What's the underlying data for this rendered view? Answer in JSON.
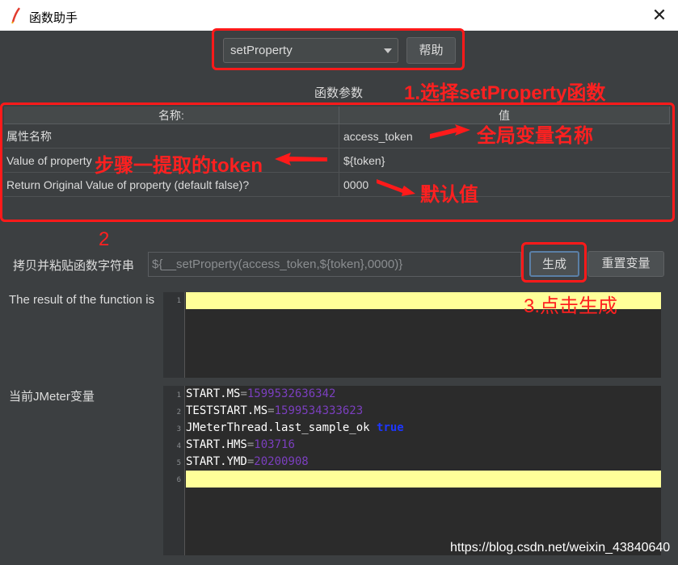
{
  "window": {
    "title": "函数助手",
    "close_glyph": "✕"
  },
  "function_select": {
    "value": "setProperty"
  },
  "help_button": "帮助",
  "params_label": "函数参数",
  "table": {
    "headers": {
      "name": "名称:",
      "value": "值"
    },
    "rows": [
      {
        "name": "属性名称",
        "value": "access_token"
      },
      {
        "name": "Value of property",
        "value": "${token}"
      },
      {
        "name": "Return Original Value of property (default false)?",
        "value": "0000"
      }
    ]
  },
  "copy_label": "拷贝并粘贴函数字符串",
  "function_string": "${__setProperty(access_token,${token},0000)}",
  "generate_button": "生成",
  "reset_button": "重置变量",
  "result_label": "The result of the function is",
  "result_editor": {
    "line_numbers": [
      "1"
    ]
  },
  "vars_label": "当前JMeter变量",
  "vars_editor": {
    "line_numbers": [
      "1",
      "2",
      "3",
      "4",
      "5",
      "6"
    ],
    "lines": [
      {
        "key": "START.MS",
        "sep": "=",
        "value": "1599532636342"
      },
      {
        "key": "TESTSTART.MS",
        "sep": "=",
        "value": "1599534333623"
      },
      {
        "key": "JMeterThread.last_sample_ok",
        "sep": " ",
        "value": "true"
      },
      {
        "key": "START.HMS",
        "sep": "=",
        "value": "103716"
      },
      {
        "key": "START.YMD",
        "sep": "=",
        "value": "20200908"
      }
    ]
  },
  "annotations": {
    "step1": "1.选择setProperty函数",
    "global_var": "全局变量名称",
    "token_step": "步骤一提取的token",
    "default_val": "默认值",
    "step2": "2",
    "step3": "3.点击生成"
  },
  "watermark": "https://blog.csdn.net/weixin_43840640",
  "colors": {
    "annotation": "#ff1a1a",
    "highlight": "#ffff99",
    "dark_bg": "#3c3f41"
  }
}
